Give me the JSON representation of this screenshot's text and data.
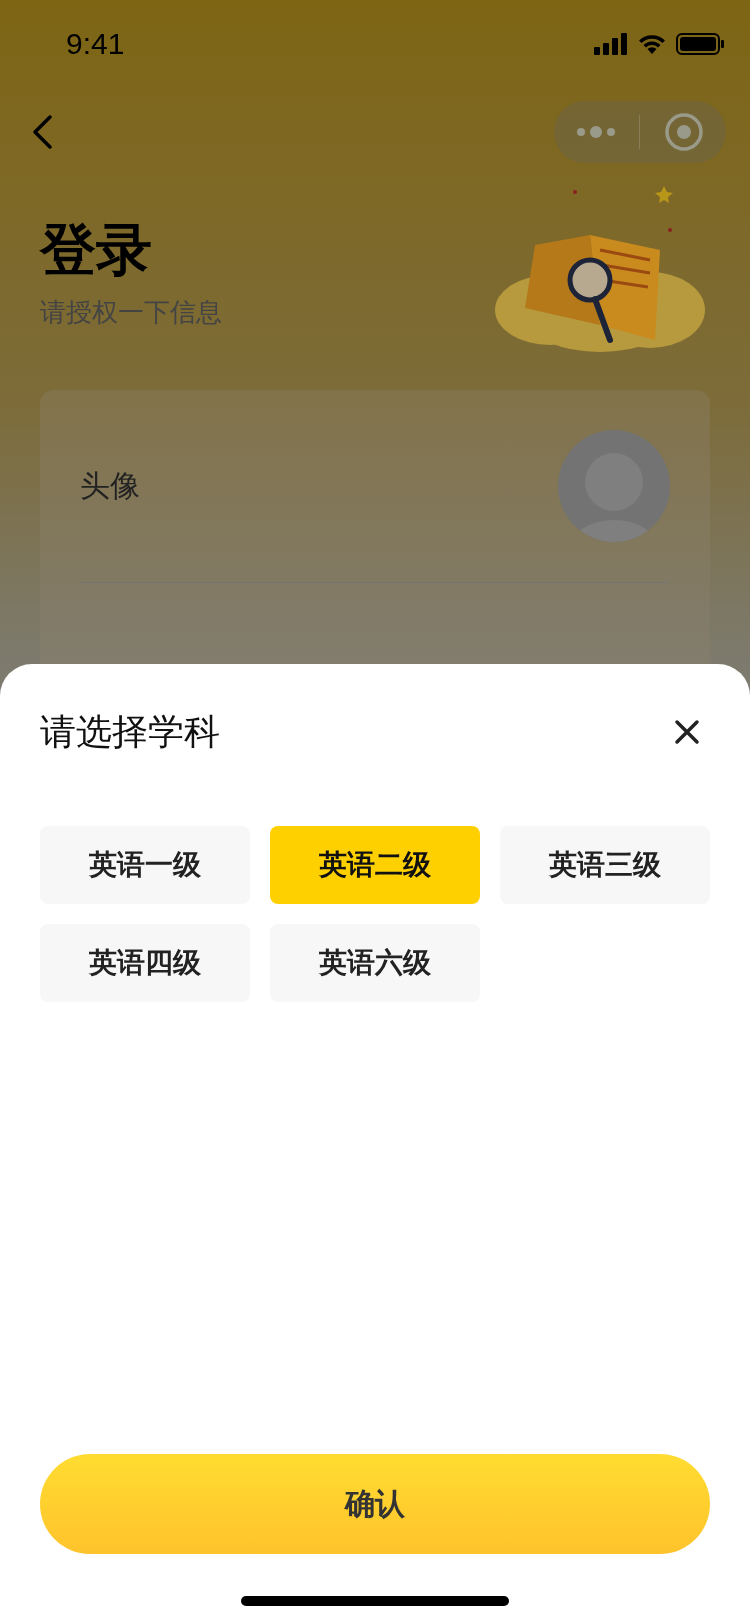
{
  "status_bar": {
    "time": "9:41"
  },
  "header": {
    "title": "登录",
    "subtitle": "请授权一下信息"
  },
  "profile": {
    "avatar_label": "头像"
  },
  "sheet": {
    "title": "请选择学科",
    "options": [
      {
        "label": "英语一级",
        "selected": false
      },
      {
        "label": "英语二级",
        "selected": true
      },
      {
        "label": "英语三级",
        "selected": false
      },
      {
        "label": "英语四级",
        "selected": false
      },
      {
        "label": "英语六级",
        "selected": false
      }
    ],
    "confirm": "确认"
  }
}
